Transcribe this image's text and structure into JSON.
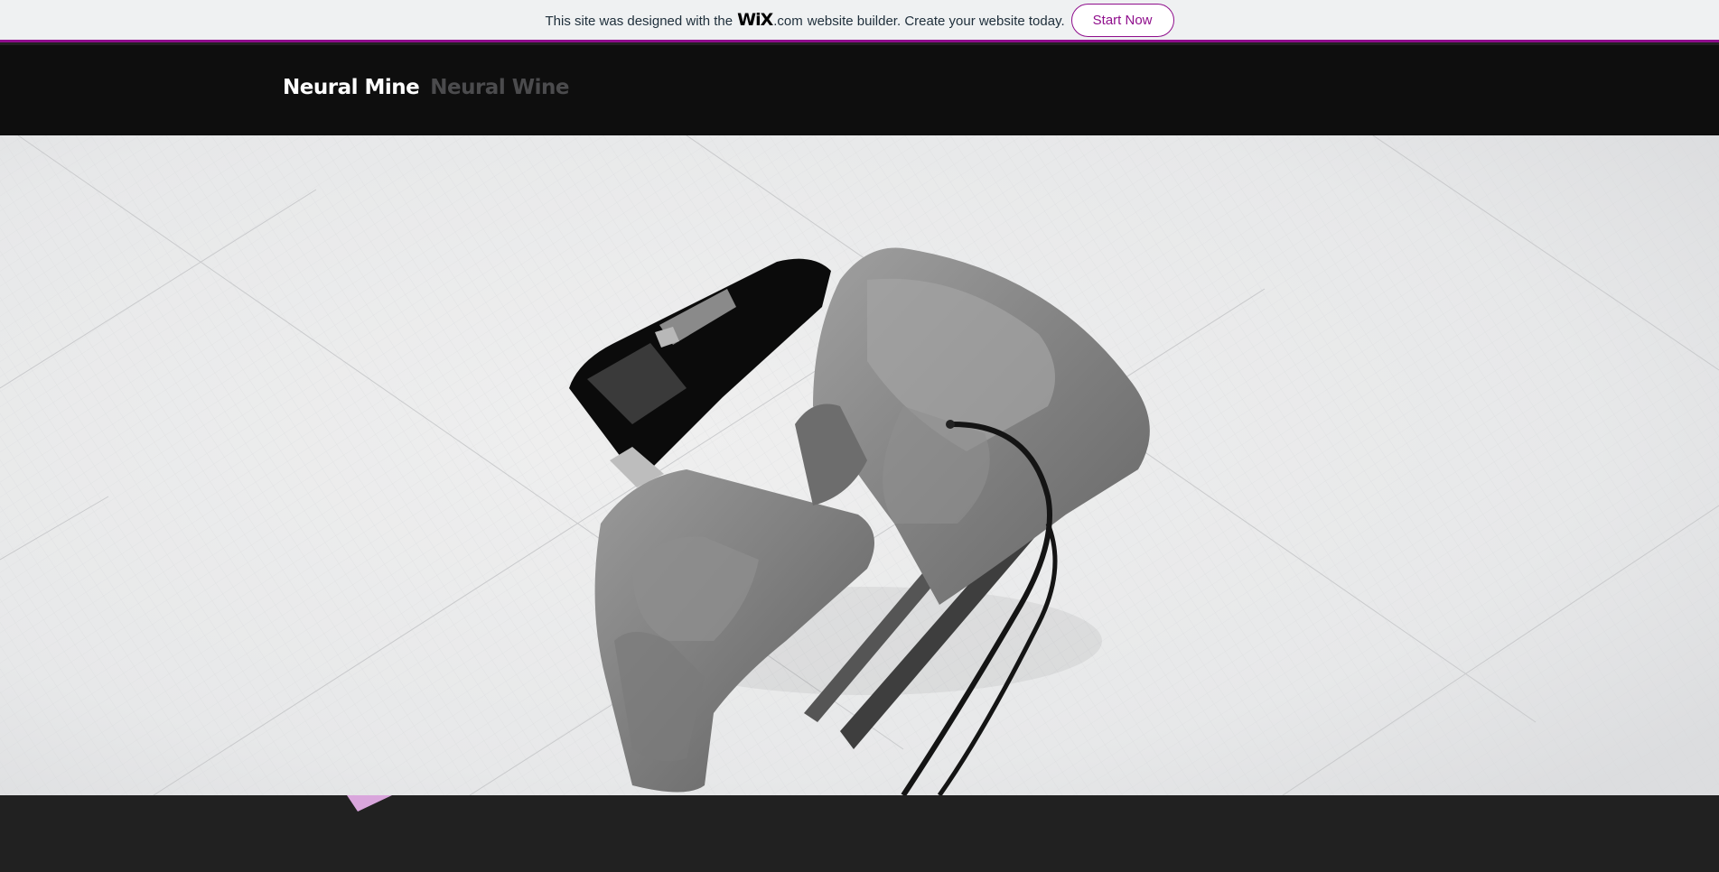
{
  "wix_banner": {
    "text_before": "This site was designed with the",
    "logo": "WiX",
    "logo_suffix": ".com",
    "text_after": "website builder. Create your website today.",
    "button_label": "Start Now",
    "accent_color": "#8f0e8c"
  },
  "header": {
    "brand_primary": "Neural Mine",
    "brand_secondary": "Neural Wine",
    "background": "#0e0e0e"
  },
  "hero": {
    "image": "massage-chair-3d-render",
    "background": "#e6e7e8"
  },
  "footer": {
    "background": "#212121",
    "decoration_icon": "pink-triangle-shape"
  }
}
